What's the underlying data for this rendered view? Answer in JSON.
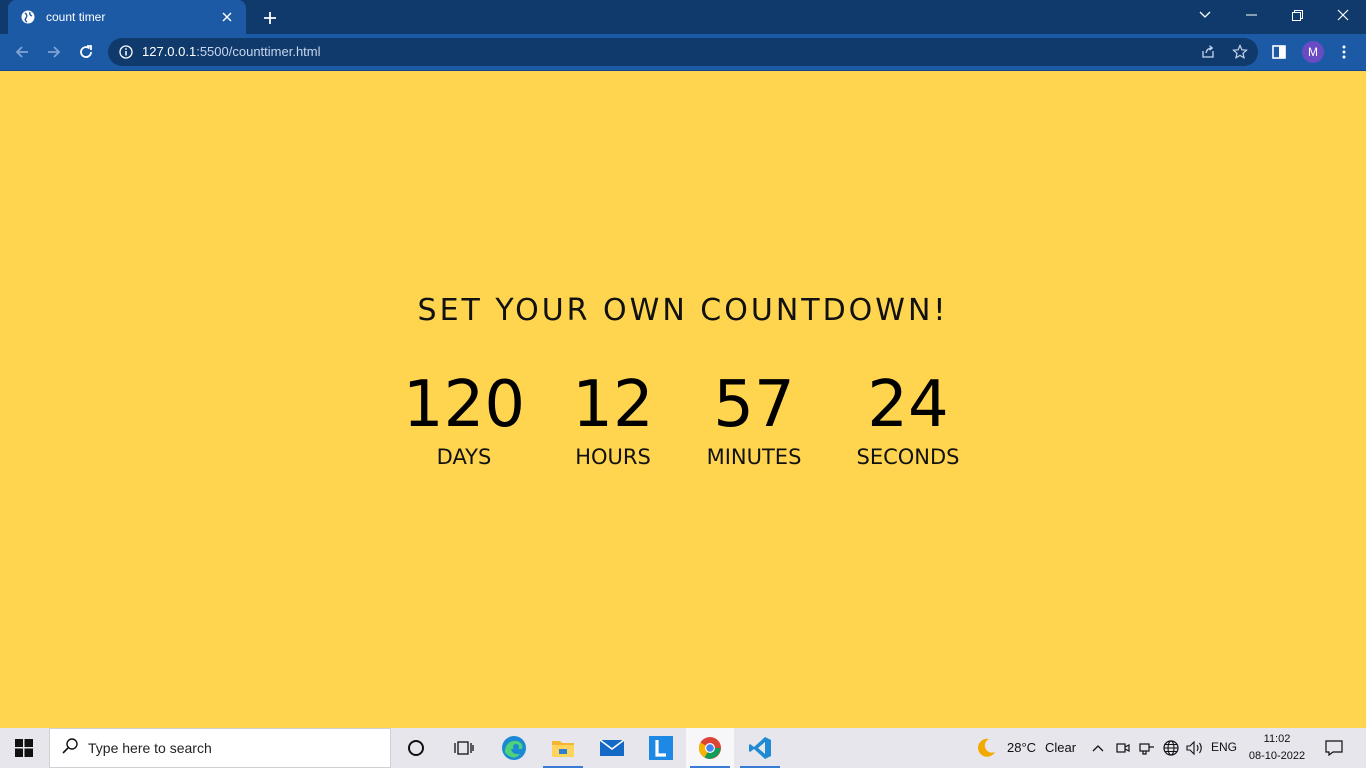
{
  "browser": {
    "tab_title": "count timer",
    "url_host": "127.0.0.1",
    "url_rest": ":5500/counttimer.html",
    "profile_initial": "M"
  },
  "page": {
    "headline": "SET YOUR OWN COUNTDOWN!",
    "units": [
      {
        "value": "120",
        "label": "DAYS"
      },
      {
        "value": "12",
        "label": "HOURS"
      },
      {
        "value": "57",
        "label": "MINUTES"
      },
      {
        "value": "24",
        "label": "SECONDS"
      }
    ],
    "background_color": "#ffd54f"
  },
  "taskbar": {
    "search_placeholder": "Type here to search",
    "weather_temp": "28°C",
    "weather_text": "Clear",
    "language": "ENG",
    "time": "11:02",
    "date": "08-10-2022",
    "apps": [
      "cortana-icon",
      "task-view-icon",
      "edge-icon",
      "file-explorer-icon",
      "mail-icon",
      "l-app-icon",
      "chrome-icon",
      "vscode-icon"
    ]
  }
}
